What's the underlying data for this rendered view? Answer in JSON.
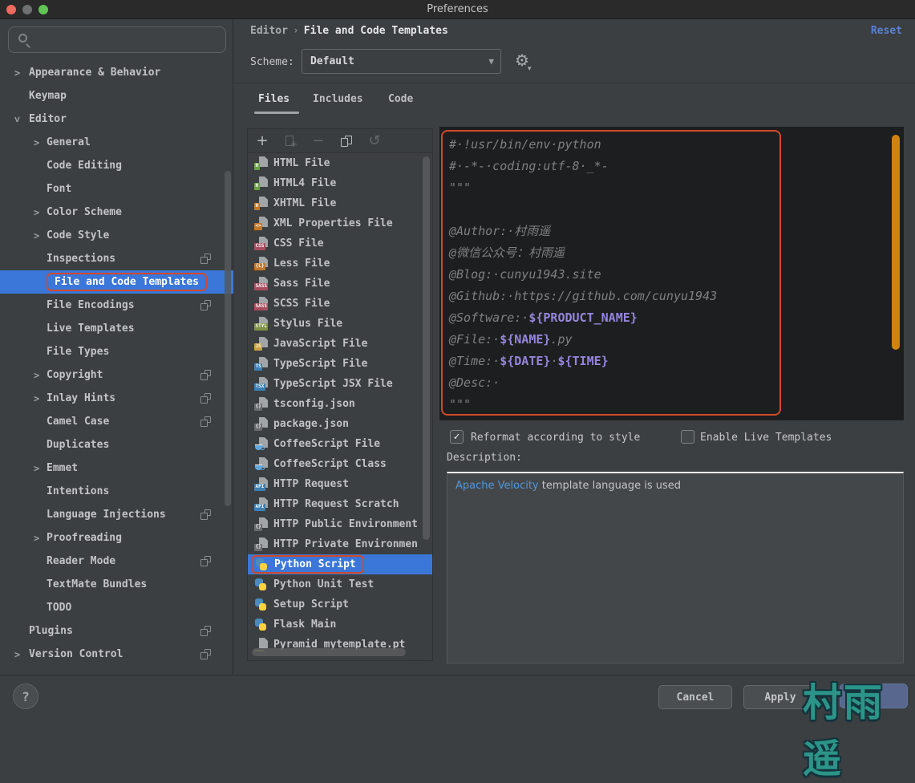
{
  "window": {
    "title": "Preferences"
  },
  "colors": {
    "background": "#3C3F41",
    "titlebar": "#2A2A2A",
    "selection_blue": "#3B77D9",
    "annotation_red": "#D1492A",
    "editor_background": "#1D1E1F",
    "editor_scrollbar_orange": "#D0830F",
    "template_variable_purple": "#9585DB",
    "link_blue": "#5297D8",
    "reset_blue": "#5881D4",
    "watermark_teal": "#2C9488"
  },
  "sidebar": {
    "search_placeholder": "",
    "tree": [
      {
        "label": "Appearance & Behavior",
        "level": 0,
        "chevron": "right"
      },
      {
        "label": "Keymap",
        "level": 0
      },
      {
        "label": "Editor",
        "level": 0,
        "chevron": "down"
      },
      {
        "label": "General",
        "level": 1,
        "chevron": "right"
      },
      {
        "label": "Code Editing",
        "level": 1
      },
      {
        "label": "Font",
        "level": 1
      },
      {
        "label": "Color Scheme",
        "level": 1,
        "chevron": "right"
      },
      {
        "label": "Code Style",
        "level": 1,
        "chevron": "right"
      },
      {
        "label": "Inspections",
        "level": 1,
        "mirror": true
      },
      {
        "label": "File and Code Templates",
        "level": 1,
        "selected": true,
        "annotated": true
      },
      {
        "label": "File Encodings",
        "level": 1,
        "mirror": true
      },
      {
        "label": "Live Templates",
        "level": 1
      },
      {
        "label": "File Types",
        "level": 1
      },
      {
        "label": "Copyright",
        "level": 1,
        "chevron": "right",
        "mirror": true
      },
      {
        "label": "Inlay Hints",
        "level": 1,
        "chevron": "right",
        "mirror": true
      },
      {
        "label": "Camel Case",
        "level": 1,
        "mirror": true
      },
      {
        "label": "Duplicates",
        "level": 1
      },
      {
        "label": "Emmet",
        "level": 1,
        "chevron": "right"
      },
      {
        "label": "Intentions",
        "level": 1
      },
      {
        "label": "Language Injections",
        "level": 1,
        "mirror": true
      },
      {
        "label": "Proofreading",
        "level": 1,
        "chevron": "right"
      },
      {
        "label": "Reader Mode",
        "level": 1,
        "mirror": true
      },
      {
        "label": "TextMate Bundles",
        "level": 1
      },
      {
        "label": "TODO",
        "level": 1
      },
      {
        "label": "Plugins",
        "level": 0,
        "mirror": true
      },
      {
        "label": "Version Control",
        "level": 0,
        "chevron": "right",
        "mirror": true
      }
    ]
  },
  "header": {
    "breadcrumb_parent": "Editor",
    "breadcrumb_sep": "›",
    "breadcrumb_current": "File and Code Templates",
    "reset_label": "Reset",
    "scheme_label": "Scheme:",
    "scheme_value": "Default"
  },
  "tabs": [
    {
      "label": "Files",
      "active": true
    },
    {
      "label": "Includes",
      "active": false
    },
    {
      "label": "Code",
      "active": false
    }
  ],
  "template_list": {
    "toolbar": [
      {
        "name": "add",
        "enabled": true
      },
      {
        "name": "create-from-template",
        "enabled": false
      },
      {
        "name": "remove",
        "enabled": false
      },
      {
        "name": "copy",
        "enabled": true
      },
      {
        "name": "reset-to-default",
        "enabled": false
      }
    ],
    "items": [
      {
        "label": "HTML File",
        "icon": "badge",
        "badge": "H",
        "color": "#69A247"
      },
      {
        "label": "HTML4 File",
        "icon": "badge",
        "badge": "H",
        "color": "#69A247"
      },
      {
        "label": "XHTML File",
        "icon": "badge",
        "badge": "H",
        "color": "#C0782E"
      },
      {
        "label": "XML Properties File",
        "icon": "badge",
        "badge": "<>",
        "color": "#C0782E"
      },
      {
        "label": "CSS File",
        "icon": "badge",
        "badge": "CSS",
        "color": "#A84D5F"
      },
      {
        "label": "Less File",
        "icon": "badge",
        "badge": "{L}",
        "color": "#C0782E"
      },
      {
        "label": "Sass File",
        "icon": "badge",
        "badge": "SASS",
        "color": "#A84D5F"
      },
      {
        "label": "SCSS File",
        "icon": "badge",
        "badge": "SASS",
        "color": "#A84D5F"
      },
      {
        "label": "Stylus File",
        "icon": "badge",
        "badge": "STYL",
        "color": "#7E9145"
      },
      {
        "label": "JavaScript File",
        "icon": "badge",
        "badge": "JS",
        "color": "#C7A43C"
      },
      {
        "label": "TypeScript File",
        "icon": "badge",
        "badge": "TS",
        "color": "#3C80B4"
      },
      {
        "label": "TypeScript JSX File",
        "icon": "badge",
        "badge": "TSX",
        "color": "#3C80B4"
      },
      {
        "label": "tsconfig.json",
        "icon": "json"
      },
      {
        "label": "package.json",
        "icon": "json"
      },
      {
        "label": "CoffeeScript File",
        "icon": "coffee"
      },
      {
        "label": "CoffeeScript Class",
        "icon": "coffee"
      },
      {
        "label": "HTTP Request",
        "icon": "badge",
        "badge": "API",
        "color": "#3C80B4"
      },
      {
        "label": "HTTP Request Scratch",
        "icon": "badge",
        "badge": "API",
        "color": "#3C80B4"
      },
      {
        "label": "HTTP Public Environment",
        "icon": "json"
      },
      {
        "label": "HTTP Private Environmen",
        "icon": "json"
      },
      {
        "label": "Python Script",
        "icon": "python",
        "selected": true,
        "annotated": true
      },
      {
        "label": "Python Unit Test",
        "icon": "python"
      },
      {
        "label": "Setup Script",
        "icon": "python"
      },
      {
        "label": "Flask Main",
        "icon": "python"
      },
      {
        "label": "Pyramid mytemplate.pt",
        "icon": "page-underline"
      }
    ]
  },
  "editor": {
    "lines": [
      [
        {
          "t": "#·!usr/bin/env·python",
          "k": "c"
        }
      ],
      [
        {
          "t": "#·-*-·coding:utf-8·_*-",
          "k": "c"
        }
      ],
      [
        {
          "t": "\"\"\"",
          "k": "c"
        }
      ],
      [
        {
          "t": "",
          "k": "c"
        }
      ],
      [
        {
          "t": "@Author:·村雨遥",
          "k": "c"
        }
      ],
      [
        {
          "t": "@微信公众号：村雨遥",
          "k": "c"
        }
      ],
      [
        {
          "t": "@Blog:·cunyu1943.site",
          "k": "c"
        }
      ],
      [
        {
          "t": "@Github:·https://github.com/cunyu1943",
          "k": "c"
        }
      ],
      [
        {
          "t": "@Software:·",
          "k": "c"
        },
        {
          "t": "${PRODUCT_NAME}",
          "k": "v"
        }
      ],
      [
        {
          "t": "@File:·",
          "k": "c"
        },
        {
          "t": "${NAME}",
          "k": "v"
        },
        {
          "t": ".py",
          "k": "c"
        }
      ],
      [
        {
          "t": "@Time:·",
          "k": "c"
        },
        {
          "t": "${DATE}",
          "k": "v"
        },
        {
          "t": "·",
          "k": "c"
        },
        {
          "t": "${TIME}",
          "k": "v"
        }
      ],
      [
        {
          "t": "@Desc:·",
          "k": "c"
        }
      ],
      [
        {
          "t": "\"\"\"",
          "k": "c"
        }
      ]
    ]
  },
  "options": {
    "reformat_label": "Reformat according to style",
    "reformat_checked": true,
    "check_glyph": "✓",
    "live_templates_label": "Enable Live Templates",
    "live_templates_checked": false
  },
  "description": {
    "label": "Description:",
    "link_text": "Apache Velocity",
    "text": " template language is used"
  },
  "footer": {
    "help_label": "?",
    "cancel_label": "Cancel",
    "apply_label": "Apply",
    "watermark": "村雨遥"
  }
}
